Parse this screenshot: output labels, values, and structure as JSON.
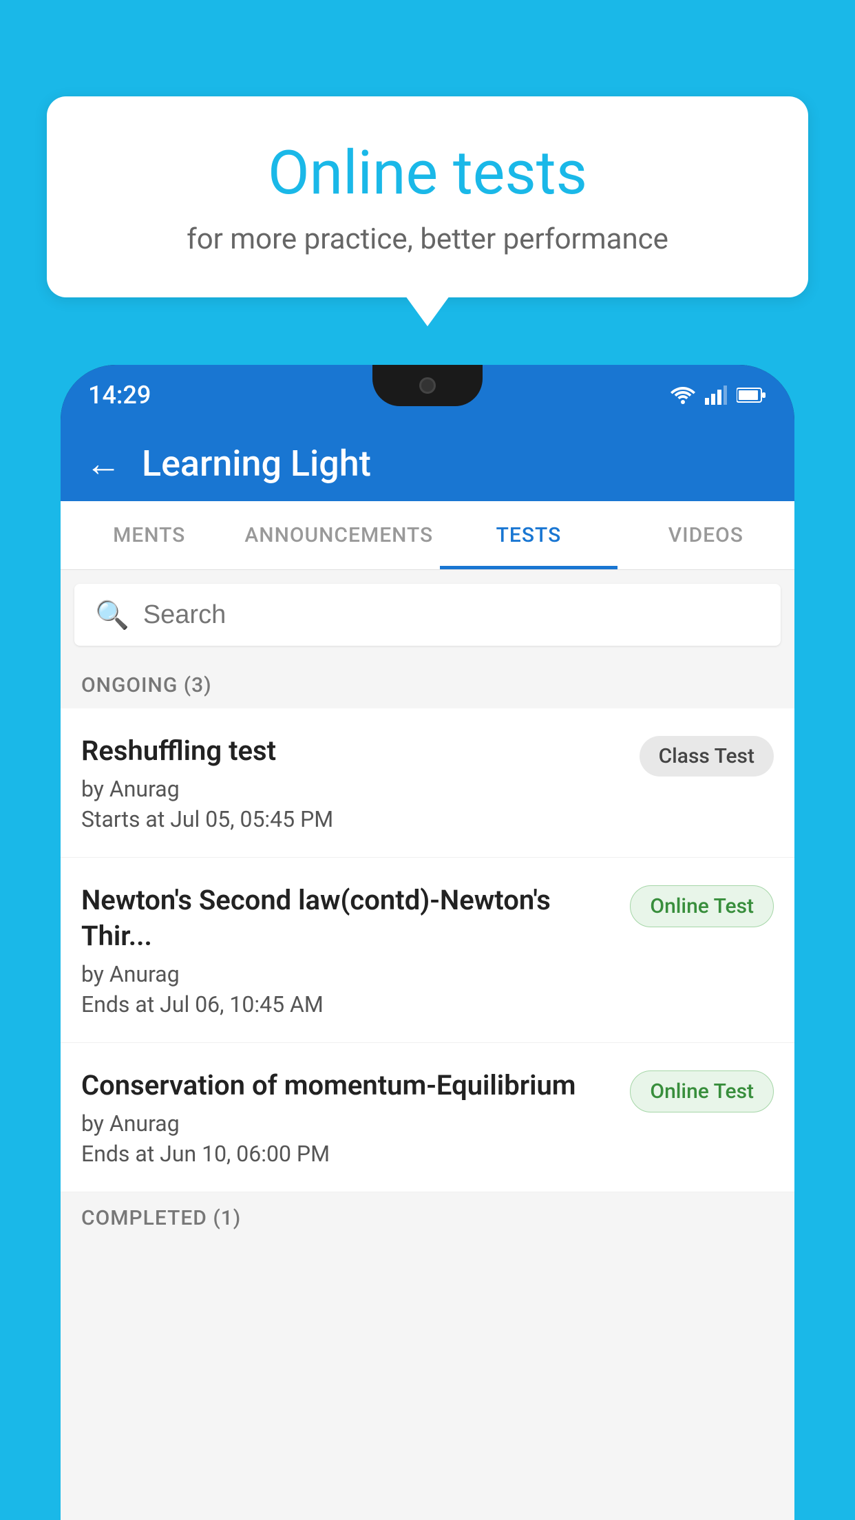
{
  "background_color": "#1ab8e8",
  "bubble": {
    "title": "Online tests",
    "subtitle": "for more practice, better performance"
  },
  "phone": {
    "status_bar": {
      "time": "14:29",
      "icons": [
        "wifi",
        "signal",
        "battery"
      ]
    },
    "app_bar": {
      "title": "Learning Light",
      "back_label": "←"
    },
    "tabs": [
      {
        "label": "MENTS",
        "active": false
      },
      {
        "label": "ANNOUNCEMENTS",
        "active": false
      },
      {
        "label": "TESTS",
        "active": true
      },
      {
        "label": "VIDEOS",
        "active": false
      }
    ],
    "search": {
      "placeholder": "Search"
    },
    "sections": [
      {
        "header": "ONGOING (3)",
        "items": [
          {
            "name": "Reshuffling test",
            "author": "by Anurag",
            "time_label": "Starts at",
            "time": "Jul 05, 05:45 PM",
            "badge": "Class Test",
            "badge_type": "class"
          },
          {
            "name": "Newton's Second law(contd)-Newton's Thir...",
            "author": "by Anurag",
            "time_label": "Ends at",
            "time": "Jul 06, 10:45 AM",
            "badge": "Online Test",
            "badge_type": "online"
          },
          {
            "name": "Conservation of momentum-Equilibrium",
            "author": "by Anurag",
            "time_label": "Ends at",
            "time": "Jun 10, 06:00 PM",
            "badge": "Online Test",
            "badge_type": "online"
          }
        ]
      }
    ],
    "completed_header": "COMPLETED (1)"
  }
}
